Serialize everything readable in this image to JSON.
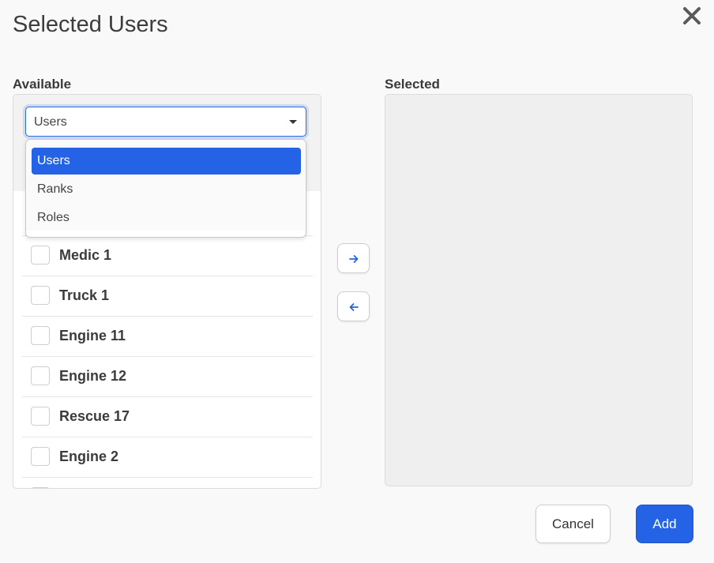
{
  "dialog": {
    "title": "Selected Users",
    "close_icon": "close-x-icon"
  },
  "available": {
    "label": "Available",
    "filter": {
      "value": "Users",
      "options": [
        "Users",
        "Ranks",
        "Roles"
      ],
      "active_index": 0
    },
    "items": [
      "Medic 1",
      "Truck 1",
      "Engine 11",
      "Engine 12",
      "Rescue 17",
      "Engine 2"
    ]
  },
  "transfer": {
    "right_icon": "arrow-right-icon",
    "left_icon": "arrow-left-icon"
  },
  "selected": {
    "label": "Selected",
    "items": []
  },
  "footer": {
    "cancel_label": "Cancel",
    "add_label": "Add"
  },
  "colors": {
    "primary": "#2563e6",
    "arrow": "#2563e6"
  }
}
